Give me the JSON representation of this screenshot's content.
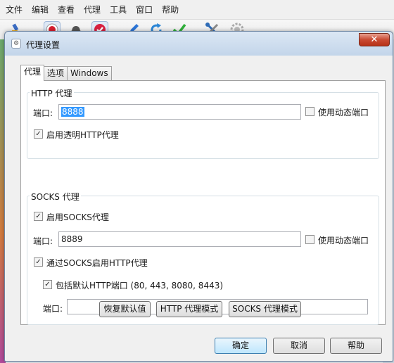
{
  "menu": [
    "文件",
    "编辑",
    "查看",
    "代理",
    "工具",
    "窗口",
    "帮助"
  ],
  "toolbar_icons": [
    "brush-icon",
    "record-icon",
    "hat-icon",
    "shield-check-icon",
    "pen-icon",
    "refresh-icon",
    "checkmark-icon",
    "tools-icon",
    "gear-icon"
  ],
  "dialog": {
    "title": "代理设置",
    "close_glyph": "✕"
  },
  "tabs": [
    "代理",
    "选项",
    "Windows"
  ],
  "http": {
    "group_label": "HTTP 代理",
    "port_label": "端口:",
    "port_value": "8888",
    "dynamic_port_label": "使用动态端口",
    "dynamic_port_checked": false,
    "transparent_label": "启用透明HTTP代理",
    "transparent_checked": true
  },
  "socks": {
    "group_label": "SOCKS 代理",
    "enable_label": "启用SOCKS代理",
    "enable_checked": true,
    "port_label": "端口:",
    "port_value": "8889",
    "dynamic_port_label": "使用动态端口",
    "dynamic_port_checked": false,
    "via_socks_label": "通过SOCKS启用HTTP代理",
    "via_socks_checked": true,
    "default_ports_label": "包括默认HTTP端口 (80, 443, 8080, 8443)",
    "default_ports_checked": true,
    "extra_port_label": "端口:",
    "extra_port_value": ""
  },
  "mode_buttons": {
    "restore": "恢复默认值",
    "http_mode": "HTTP 代理模式",
    "socks_mode": "SOCKS 代理模式"
  },
  "footer": {
    "ok": "确定",
    "cancel": "取消",
    "help": "帮助"
  }
}
